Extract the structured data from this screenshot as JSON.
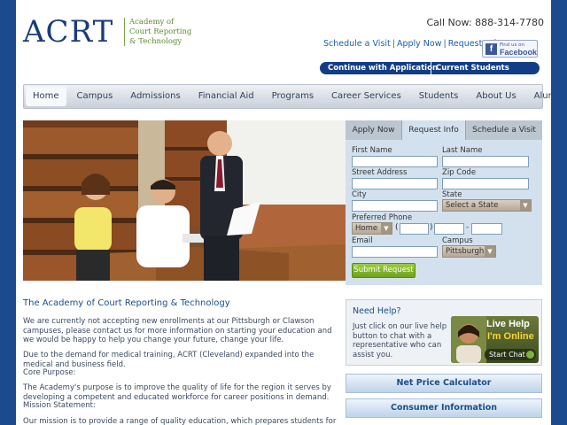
{
  "header": {
    "logo_text": "ACRT",
    "logo_sub": [
      "Academy of",
      "Court Reporting",
      "& Technology"
    ],
    "call_now": "Call Now: 888-314-7780",
    "links": [
      "Schedule a Visit",
      "Apply Now",
      "Request Info"
    ],
    "facebook": {
      "line1": "Find us on",
      "line2": "Facebook"
    },
    "cta_continue": "Continue with Application",
    "cta_students": "Current Students"
  },
  "nav": [
    "Home",
    "Campus",
    "Admissions",
    "Financial Aid",
    "Programs",
    "Career Services",
    "Students",
    "About Us",
    "Alumni"
  ],
  "form": {
    "tabs": [
      "Apply Now",
      "Request Info",
      "Schedule a Visit"
    ],
    "first_name": "First Name",
    "last_name": "Last Name",
    "street": "Street Address",
    "zip": "Zip Code",
    "city": "City",
    "state": "State",
    "state_value": "Select a State",
    "phone": "Preferred Phone",
    "phone_type": "Home",
    "email": "Email",
    "campus": "Campus",
    "campus_value": "Pittsburgh",
    "submit": "Submit Request"
  },
  "main": {
    "title": "The Academy of Court Reporting & Technology",
    "p1": "We are currently not accepting new enrollments at our Pittsburgh or Clawson campuses, please contact us for more information on starting your education and we would be happy to help you change your future, change your life.",
    "p2": "Due to the demand for medical training, ACRT (Cleveland) expanded into the medical and business field.",
    "p2b": "Core Purpose:",
    "p3": "The Academy's purpose is to improve the quality of life for the region it serves by developing a competent and educated workforce for career positions in demand.",
    "p3b": "Mission Statement:",
    "p4": "Our mission is to provide a range of quality education, which prepares students for"
  },
  "help": {
    "title": "Need Help?",
    "text": "Just click on our live help button to chat with a representative who can assist you.",
    "chat_l1": "Live Help",
    "chat_l2": "I'm Online",
    "chat_l3": "Start Chat"
  },
  "side_buttons": [
    "Net Price Calculator",
    "Consumer Information"
  ]
}
